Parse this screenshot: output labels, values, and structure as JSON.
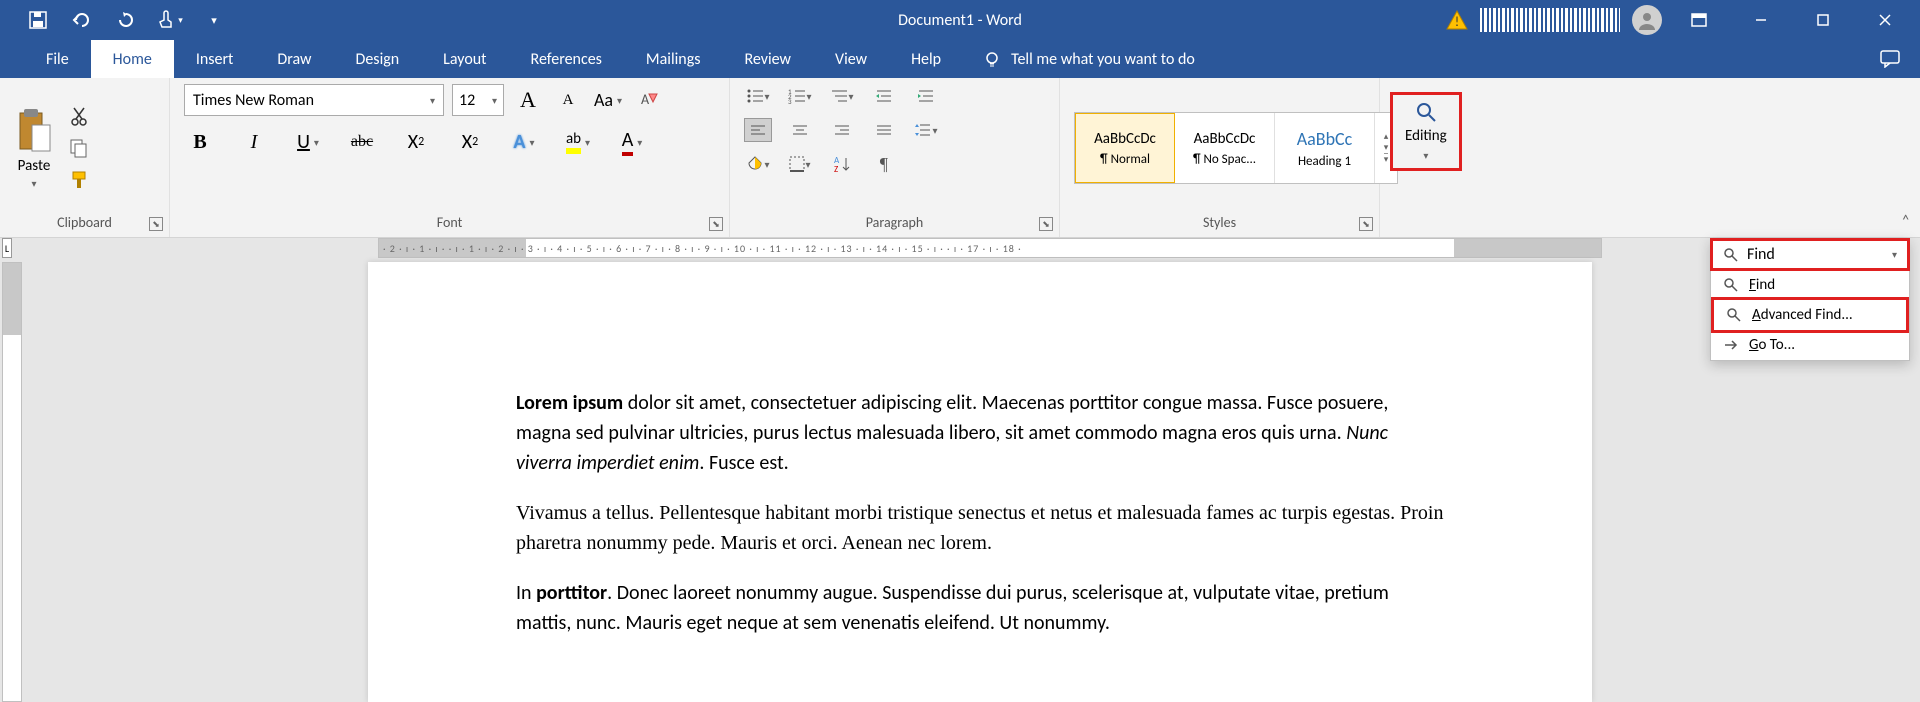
{
  "title": {
    "doc": "Document1",
    "sep": "  -  ",
    "app": "Word"
  },
  "tabs": [
    "File",
    "Home",
    "Insert",
    "Draw",
    "Design",
    "Layout",
    "References",
    "Mailings",
    "Review",
    "View",
    "Help"
  ],
  "active_tab": 1,
  "tellme": "Tell me what you want to do",
  "clipboard": {
    "label": "Clipboard",
    "paste": "Paste"
  },
  "font": {
    "label": "Font",
    "name": "Times New Roman",
    "size": "12",
    "grow": "A",
    "shrink": "A",
    "case": "Aa",
    "clear": "⌫",
    "bold": "B",
    "italic": "I",
    "underline": "U",
    "strike": "abc",
    "sub": "2",
    "sup": "2",
    "sublbl": "X",
    "suplbl": "X",
    "texteffects": "A",
    "highlight": "ab",
    "fontcolor": "A"
  },
  "paragraph": {
    "label": "Paragraph"
  },
  "styles": {
    "label": "Styles",
    "items": [
      {
        "preview": "AaBbCcDc",
        "name": "¶ Normal"
      },
      {
        "preview": "AaBbCcDc",
        "name": "¶ No Spac..."
      },
      {
        "preview": "AaBbCc",
        "name": "Heading 1"
      }
    ]
  },
  "editing": {
    "label": "Editing"
  },
  "find_menu": {
    "head": "Find",
    "items": [
      {
        "icon": "search",
        "label": "Find",
        "u": "F"
      },
      {
        "icon": "search",
        "label": "Advanced Find...",
        "u": "A",
        "hl": true
      },
      {
        "icon": "arrow",
        "label": "Go To...",
        "u": "G"
      }
    ]
  },
  "ruler_h": "· 2 · ı · 1 · ı ·      · ı · 1 · ı · 2 · ı · 3 · ı · 4 · ı · 5 · ı · 6 · ı · 7 · ı · 8 · ı · 9 · ı · 10 · ı · 11 · ı · 12 · ı · 13 · ı · 14 · ı · 15 · ı ·     · ı · 17 · ı · 18 ·",
  "body": {
    "p1a": "Lorem ipsum",
    "p1b": " dolor sit amet, consectetuer adipiscing elit. Maecenas porttitor congue massa. Fusce posuere, magna sed pulvinar ultricies, purus lectus malesuada libero, sit amet commodo magna eros quis urna. ",
    "p1c": "Nunc viverra imperdiet enim",
    "p1d": ". Fusce est.",
    "p2": "Vivamus a tellus. Pellentesque habitant morbi tristique senectus et netus et malesuada fames ac turpis egestas. Proin pharetra nonummy pede. Mauris et orci. Aenean nec lorem.",
    "p3a": "In ",
    "p3b": "porttitor",
    "p3c": ". Donec laoreet nonummy augue. Suspendisse dui purus, scelerisque at, vulputate vitae, pretium mattis, nunc. Mauris eget neque at sem venenatis eleifend. Ut nonummy."
  }
}
